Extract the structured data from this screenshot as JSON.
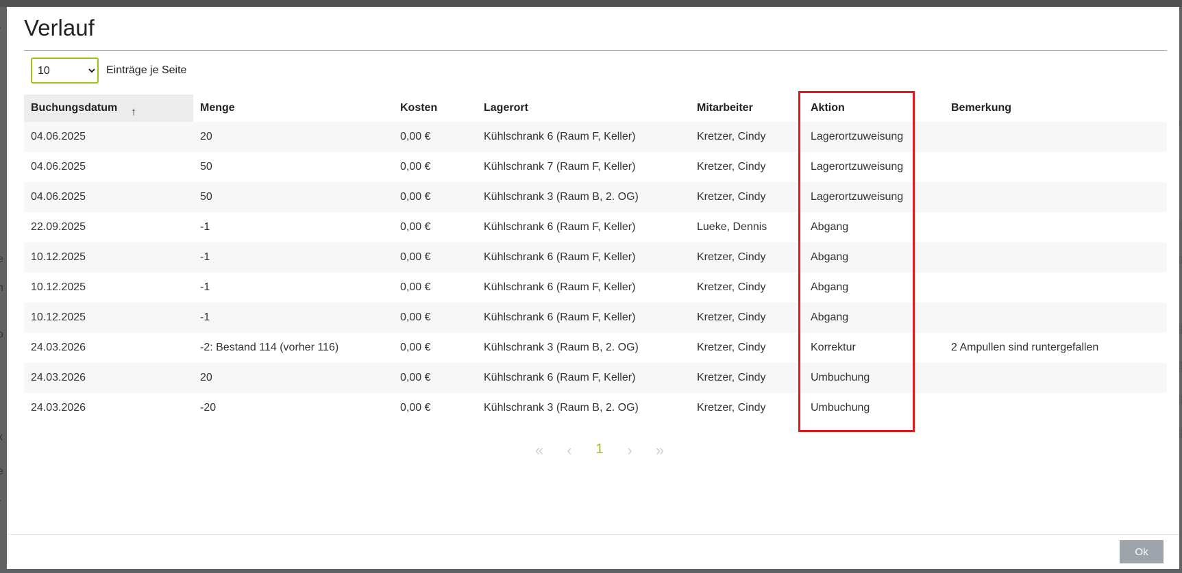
{
  "modal": {
    "title": "Verlauf",
    "page_size": {
      "selected": "10",
      "label": "Einträge je Seite"
    },
    "ok_label": "Ok"
  },
  "table": {
    "columns": [
      "Buchungsdatum",
      "Menge",
      "Kosten",
      "Lagerort",
      "Mitarbeiter",
      "Aktion",
      "Bemerkung"
    ],
    "sort_indicator": "↑",
    "rows": [
      [
        "04.06.2025",
        "20",
        "0,00 €",
        "Kühlschrank 6 (Raum F, Keller)",
        "Kretzer, Cindy",
        "Lagerortzuweisung",
        ""
      ],
      [
        "04.06.2025",
        "50",
        "0,00 €",
        "Kühlschrank 7 (Raum F, Keller)",
        "Kretzer, Cindy",
        "Lagerortzuweisung",
        ""
      ],
      [
        "04.06.2025",
        "50",
        "0,00 €",
        "Kühlschrank 3 (Raum B, 2. OG)",
        "Kretzer, Cindy",
        "Lagerortzuweisung",
        ""
      ],
      [
        "22.09.2025",
        "-1",
        "0,00 €",
        "Kühlschrank 6 (Raum F, Keller)",
        "Lueke, Dennis",
        "Abgang",
        ""
      ],
      [
        "10.12.2025",
        "-1",
        "0,00 €",
        "Kühlschrank 6 (Raum F, Keller)",
        "Kretzer, Cindy",
        "Abgang",
        ""
      ],
      [
        "10.12.2025",
        "-1",
        "0,00 €",
        "Kühlschrank 6 (Raum F, Keller)",
        "Kretzer, Cindy",
        "Abgang",
        ""
      ],
      [
        "10.12.2025",
        "-1",
        "0,00 €",
        "Kühlschrank 6 (Raum F, Keller)",
        "Kretzer, Cindy",
        "Abgang",
        ""
      ],
      [
        "24.03.2026",
        "-2: Bestand 114 (vorher 116)",
        "0,00 €",
        "Kühlschrank 3 (Raum B, 2. OG)",
        "Kretzer, Cindy",
        "Korrektur",
        "2 Ampullen sind runtergefallen"
      ],
      [
        "24.03.2026",
        "20",
        "0,00 €",
        "Kühlschrank 6 (Raum F, Keller)",
        "Kretzer, Cindy",
        "Umbuchung",
        ""
      ],
      [
        "24.03.2026",
        "-20",
        "0,00 €",
        "Kühlschrank 3 (Raum B, 2. OG)",
        "Kretzer, Cindy",
        "Umbuchung",
        ""
      ]
    ]
  },
  "pagination": {
    "first": "«",
    "prev": "‹",
    "current": "1",
    "next": "›",
    "last": "»"
  },
  "colors": {
    "accent": "#9bc31c",
    "highlight": "#e2191e",
    "ok_button": "#9da4ab"
  }
}
